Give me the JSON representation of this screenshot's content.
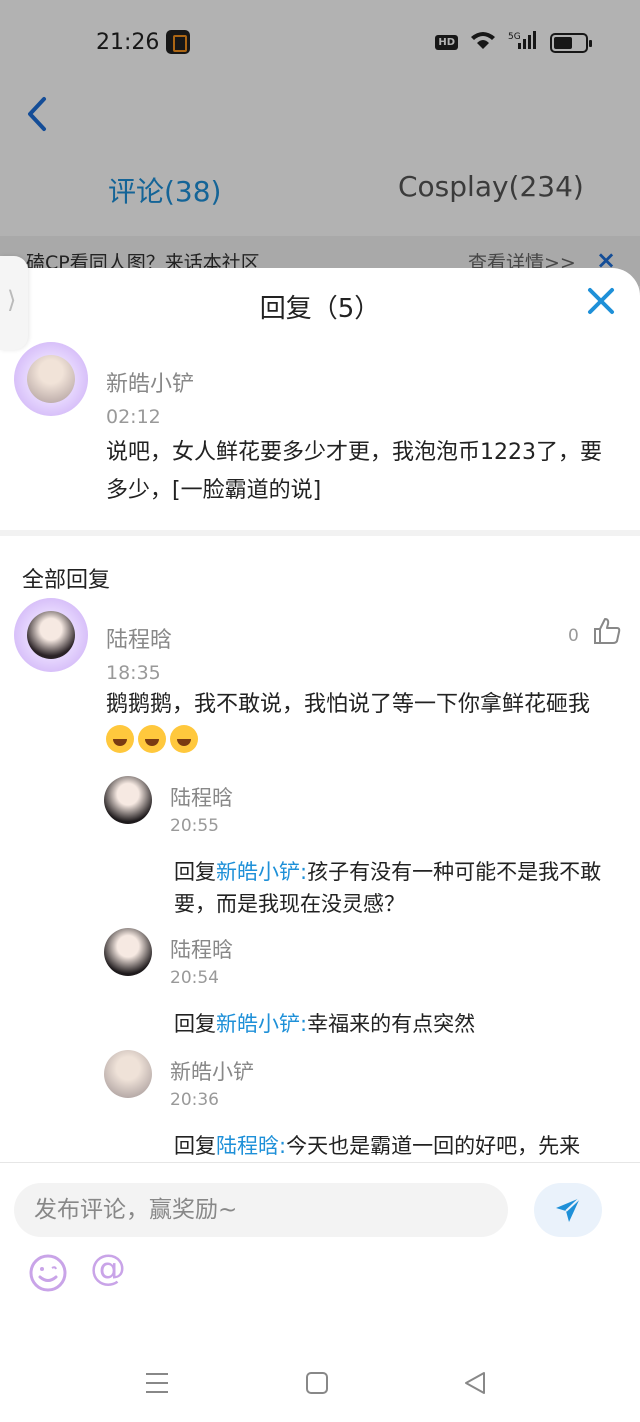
{
  "status_bar": {
    "time": "21:26",
    "hd_badge": "HD",
    "network": "5G"
  },
  "header": {
    "tabs": [
      {
        "label": "评论(38)"
      },
      {
        "label": "Cosplay(234)"
      }
    ]
  },
  "banner": {
    "text": "磕CP看同人图？来话本社区",
    "link": "查看详情>>",
    "close": "×"
  },
  "side_tab": {
    "glyph": "⟩"
  },
  "sheet": {
    "title": "回复（5）",
    "original": {
      "author": "新皓小铲",
      "time": "02:12",
      "text": "说吧，女人鲜花要多少才更，我泡泡币1223了，要多少，[一脸霸道的说]"
    },
    "all_replies_label": "全部回复",
    "comment": {
      "author": "陆程晗",
      "likes": "0",
      "time": "18:35",
      "text": "鹅鹅鹅，我不敢说，我怕说了等一下你拿鲜花砸我"
    },
    "replies": [
      {
        "author": "陆程晗",
        "time": "20:55",
        "prefix": "回复",
        "mention": "新皓小铲:",
        "text": "孩子有没有一种可能不是我不敢要，而是我现在没灵感？"
      },
      {
        "author": "陆程晗",
        "time": "20:54",
        "prefix": "回复",
        "mention": "新皓小铲:",
        "text": "幸福来的有点突然"
      },
      {
        "author": "新皓小铲",
        "time": "20:36",
        "prefix": "回复",
        "mention": "陆程晗:",
        "text": "今天也是霸道一回的好吧，先来"
      }
    ]
  },
  "input": {
    "placeholder": "发布评论，赢奖励~",
    "at_symbol": "@"
  },
  "colors": {
    "accent": "#1e90d8",
    "close": "#1e90d8",
    "emoji_tint": "#c9a4e8"
  }
}
